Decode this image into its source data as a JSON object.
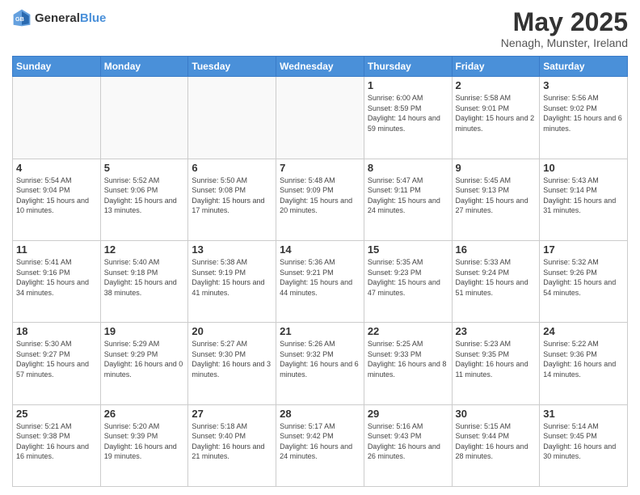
{
  "header": {
    "logo": {
      "general": "General",
      "blue": "Blue"
    },
    "title": "May 2025",
    "location": "Nenagh, Munster, Ireland"
  },
  "calendar": {
    "weekdays": [
      "Sunday",
      "Monday",
      "Tuesday",
      "Wednesday",
      "Thursday",
      "Friday",
      "Saturday"
    ],
    "weeks": [
      [
        {
          "day": "",
          "sunrise": "",
          "sunset": "",
          "daylight": "",
          "empty": true
        },
        {
          "day": "",
          "sunrise": "",
          "sunset": "",
          "daylight": "",
          "empty": true
        },
        {
          "day": "",
          "sunrise": "",
          "sunset": "",
          "daylight": "",
          "empty": true
        },
        {
          "day": "",
          "sunrise": "",
          "sunset": "",
          "daylight": "",
          "empty": true
        },
        {
          "day": "1",
          "sunrise": "Sunrise: 6:00 AM",
          "sunset": "Sunset: 8:59 PM",
          "daylight": "Daylight: 14 hours and 59 minutes."
        },
        {
          "day": "2",
          "sunrise": "Sunrise: 5:58 AM",
          "sunset": "Sunset: 9:01 PM",
          "daylight": "Daylight: 15 hours and 2 minutes."
        },
        {
          "day": "3",
          "sunrise": "Sunrise: 5:56 AM",
          "sunset": "Sunset: 9:02 PM",
          "daylight": "Daylight: 15 hours and 6 minutes."
        }
      ],
      [
        {
          "day": "4",
          "sunrise": "Sunrise: 5:54 AM",
          "sunset": "Sunset: 9:04 PM",
          "daylight": "Daylight: 15 hours and 10 minutes."
        },
        {
          "day": "5",
          "sunrise": "Sunrise: 5:52 AM",
          "sunset": "Sunset: 9:06 PM",
          "daylight": "Daylight: 15 hours and 13 minutes."
        },
        {
          "day": "6",
          "sunrise": "Sunrise: 5:50 AM",
          "sunset": "Sunset: 9:08 PM",
          "daylight": "Daylight: 15 hours and 17 minutes."
        },
        {
          "day": "7",
          "sunrise": "Sunrise: 5:48 AM",
          "sunset": "Sunset: 9:09 PM",
          "daylight": "Daylight: 15 hours and 20 minutes."
        },
        {
          "day": "8",
          "sunrise": "Sunrise: 5:47 AM",
          "sunset": "Sunset: 9:11 PM",
          "daylight": "Daylight: 15 hours and 24 minutes."
        },
        {
          "day": "9",
          "sunrise": "Sunrise: 5:45 AM",
          "sunset": "Sunset: 9:13 PM",
          "daylight": "Daylight: 15 hours and 27 minutes."
        },
        {
          "day": "10",
          "sunrise": "Sunrise: 5:43 AM",
          "sunset": "Sunset: 9:14 PM",
          "daylight": "Daylight: 15 hours and 31 minutes."
        }
      ],
      [
        {
          "day": "11",
          "sunrise": "Sunrise: 5:41 AM",
          "sunset": "Sunset: 9:16 PM",
          "daylight": "Daylight: 15 hours and 34 minutes."
        },
        {
          "day": "12",
          "sunrise": "Sunrise: 5:40 AM",
          "sunset": "Sunset: 9:18 PM",
          "daylight": "Daylight: 15 hours and 38 minutes."
        },
        {
          "day": "13",
          "sunrise": "Sunrise: 5:38 AM",
          "sunset": "Sunset: 9:19 PM",
          "daylight": "Daylight: 15 hours and 41 minutes."
        },
        {
          "day": "14",
          "sunrise": "Sunrise: 5:36 AM",
          "sunset": "Sunset: 9:21 PM",
          "daylight": "Daylight: 15 hours and 44 minutes."
        },
        {
          "day": "15",
          "sunrise": "Sunrise: 5:35 AM",
          "sunset": "Sunset: 9:23 PM",
          "daylight": "Daylight: 15 hours and 47 minutes."
        },
        {
          "day": "16",
          "sunrise": "Sunrise: 5:33 AM",
          "sunset": "Sunset: 9:24 PM",
          "daylight": "Daylight: 15 hours and 51 minutes."
        },
        {
          "day": "17",
          "sunrise": "Sunrise: 5:32 AM",
          "sunset": "Sunset: 9:26 PM",
          "daylight": "Daylight: 15 hours and 54 minutes."
        }
      ],
      [
        {
          "day": "18",
          "sunrise": "Sunrise: 5:30 AM",
          "sunset": "Sunset: 9:27 PM",
          "daylight": "Daylight: 15 hours and 57 minutes."
        },
        {
          "day": "19",
          "sunrise": "Sunrise: 5:29 AM",
          "sunset": "Sunset: 9:29 PM",
          "daylight": "Daylight: 16 hours and 0 minutes."
        },
        {
          "day": "20",
          "sunrise": "Sunrise: 5:27 AM",
          "sunset": "Sunset: 9:30 PM",
          "daylight": "Daylight: 16 hours and 3 minutes."
        },
        {
          "day": "21",
          "sunrise": "Sunrise: 5:26 AM",
          "sunset": "Sunset: 9:32 PM",
          "daylight": "Daylight: 16 hours and 6 minutes."
        },
        {
          "day": "22",
          "sunrise": "Sunrise: 5:25 AM",
          "sunset": "Sunset: 9:33 PM",
          "daylight": "Daylight: 16 hours and 8 minutes."
        },
        {
          "day": "23",
          "sunrise": "Sunrise: 5:23 AM",
          "sunset": "Sunset: 9:35 PM",
          "daylight": "Daylight: 16 hours and 11 minutes."
        },
        {
          "day": "24",
          "sunrise": "Sunrise: 5:22 AM",
          "sunset": "Sunset: 9:36 PM",
          "daylight": "Daylight: 16 hours and 14 minutes."
        }
      ],
      [
        {
          "day": "25",
          "sunrise": "Sunrise: 5:21 AM",
          "sunset": "Sunset: 9:38 PM",
          "daylight": "Daylight: 16 hours and 16 minutes."
        },
        {
          "day": "26",
          "sunrise": "Sunrise: 5:20 AM",
          "sunset": "Sunset: 9:39 PM",
          "daylight": "Daylight: 16 hours and 19 minutes."
        },
        {
          "day": "27",
          "sunrise": "Sunrise: 5:18 AM",
          "sunset": "Sunset: 9:40 PM",
          "daylight": "Daylight: 16 hours and 21 minutes."
        },
        {
          "day": "28",
          "sunrise": "Sunrise: 5:17 AM",
          "sunset": "Sunset: 9:42 PM",
          "daylight": "Daylight: 16 hours and 24 minutes."
        },
        {
          "day": "29",
          "sunrise": "Sunrise: 5:16 AM",
          "sunset": "Sunset: 9:43 PM",
          "daylight": "Daylight: 16 hours and 26 minutes."
        },
        {
          "day": "30",
          "sunrise": "Sunrise: 5:15 AM",
          "sunset": "Sunset: 9:44 PM",
          "daylight": "Daylight: 16 hours and 28 minutes."
        },
        {
          "day": "31",
          "sunrise": "Sunrise: 5:14 AM",
          "sunset": "Sunset: 9:45 PM",
          "daylight": "Daylight: 16 hours and 30 minutes."
        }
      ]
    ]
  }
}
